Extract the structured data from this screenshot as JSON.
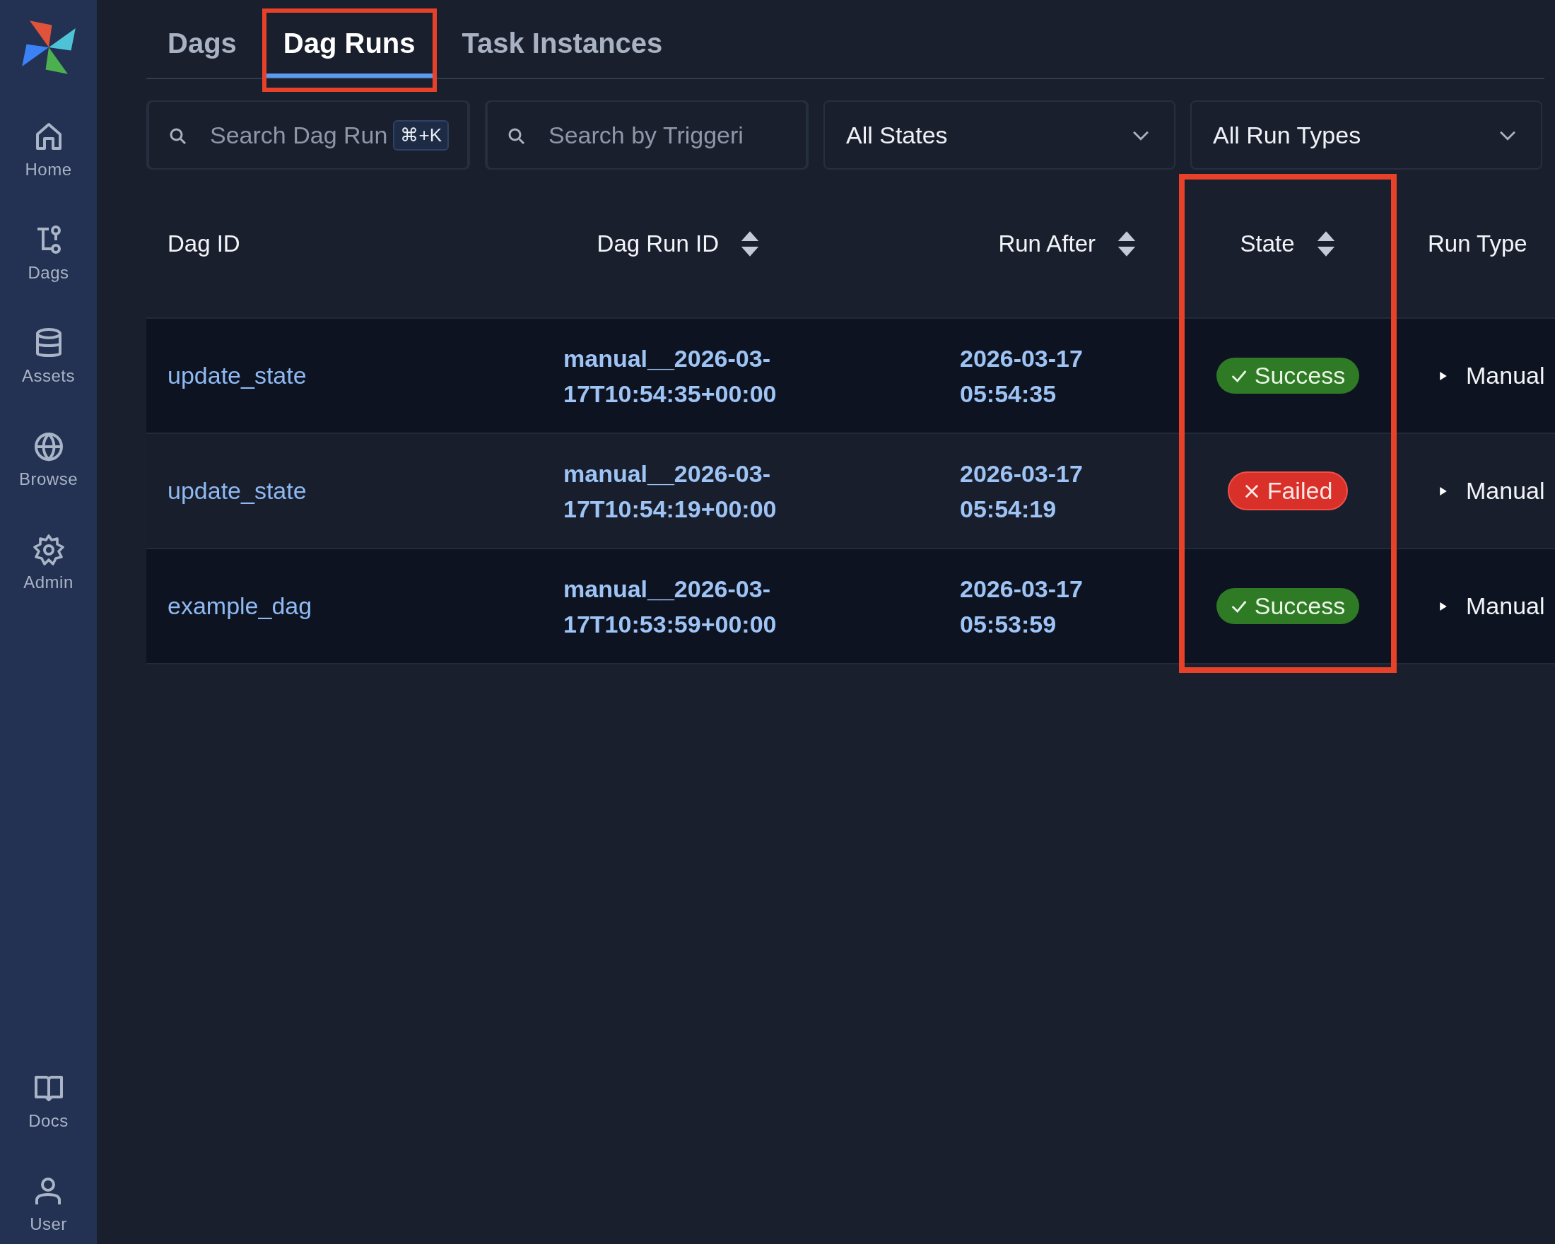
{
  "sidebar": {
    "items": [
      {
        "label": "Home"
      },
      {
        "label": "Dags"
      },
      {
        "label": "Assets"
      },
      {
        "label": "Browse"
      },
      {
        "label": "Admin"
      }
    ],
    "bottom_items": [
      {
        "label": "Docs"
      },
      {
        "label": "User"
      }
    ]
  },
  "tabs": [
    {
      "label": "Dags",
      "selected": false,
      "highlighted": false
    },
    {
      "label": "Dag Runs",
      "selected": true,
      "highlighted": true
    },
    {
      "label": "Task Instances",
      "selected": false,
      "highlighted": false
    }
  ],
  "filters": {
    "search_runs": {
      "placeholder": "Search Dag Run",
      "shortcut": "⌘+K"
    },
    "search_trigger": {
      "placeholder": "Search by Triggeri"
    },
    "state_select": {
      "value": "All States"
    },
    "run_type_select": {
      "value": "All Run Types"
    }
  },
  "table": {
    "columns": [
      {
        "label": "Dag ID",
        "sortable": false,
        "highlighted": false
      },
      {
        "label": "Dag Run ID",
        "sortable": true,
        "highlighted": false
      },
      {
        "label": "Run After",
        "sortable": true,
        "highlighted": false
      },
      {
        "label": "State",
        "sortable": true,
        "highlighted": true
      },
      {
        "label": "Run Type",
        "sortable": false,
        "highlighted": false
      }
    ],
    "rows": [
      {
        "dag_id": "update_state",
        "run_id": "manual__2026-03-17T10:54:35+00:00",
        "run_after": "2026-03-17 05:54:35",
        "state": {
          "label": "Success",
          "kind": "success"
        },
        "run_type": "Manual"
      },
      {
        "dag_id": "update_state",
        "run_id": "manual__2026-03-17T10:54:19+00:00",
        "run_after": "2026-03-17 05:54:19",
        "state": {
          "label": "Failed",
          "kind": "failed"
        },
        "run_type": "Manual"
      },
      {
        "dag_id": "example_dag",
        "run_id": "manual__2026-03-17T10:53:59+00:00",
        "run_after": "2026-03-17 05:53:59",
        "state": {
          "label": "Success",
          "kind": "success"
        },
        "run_type": "Manual"
      }
    ]
  }
}
